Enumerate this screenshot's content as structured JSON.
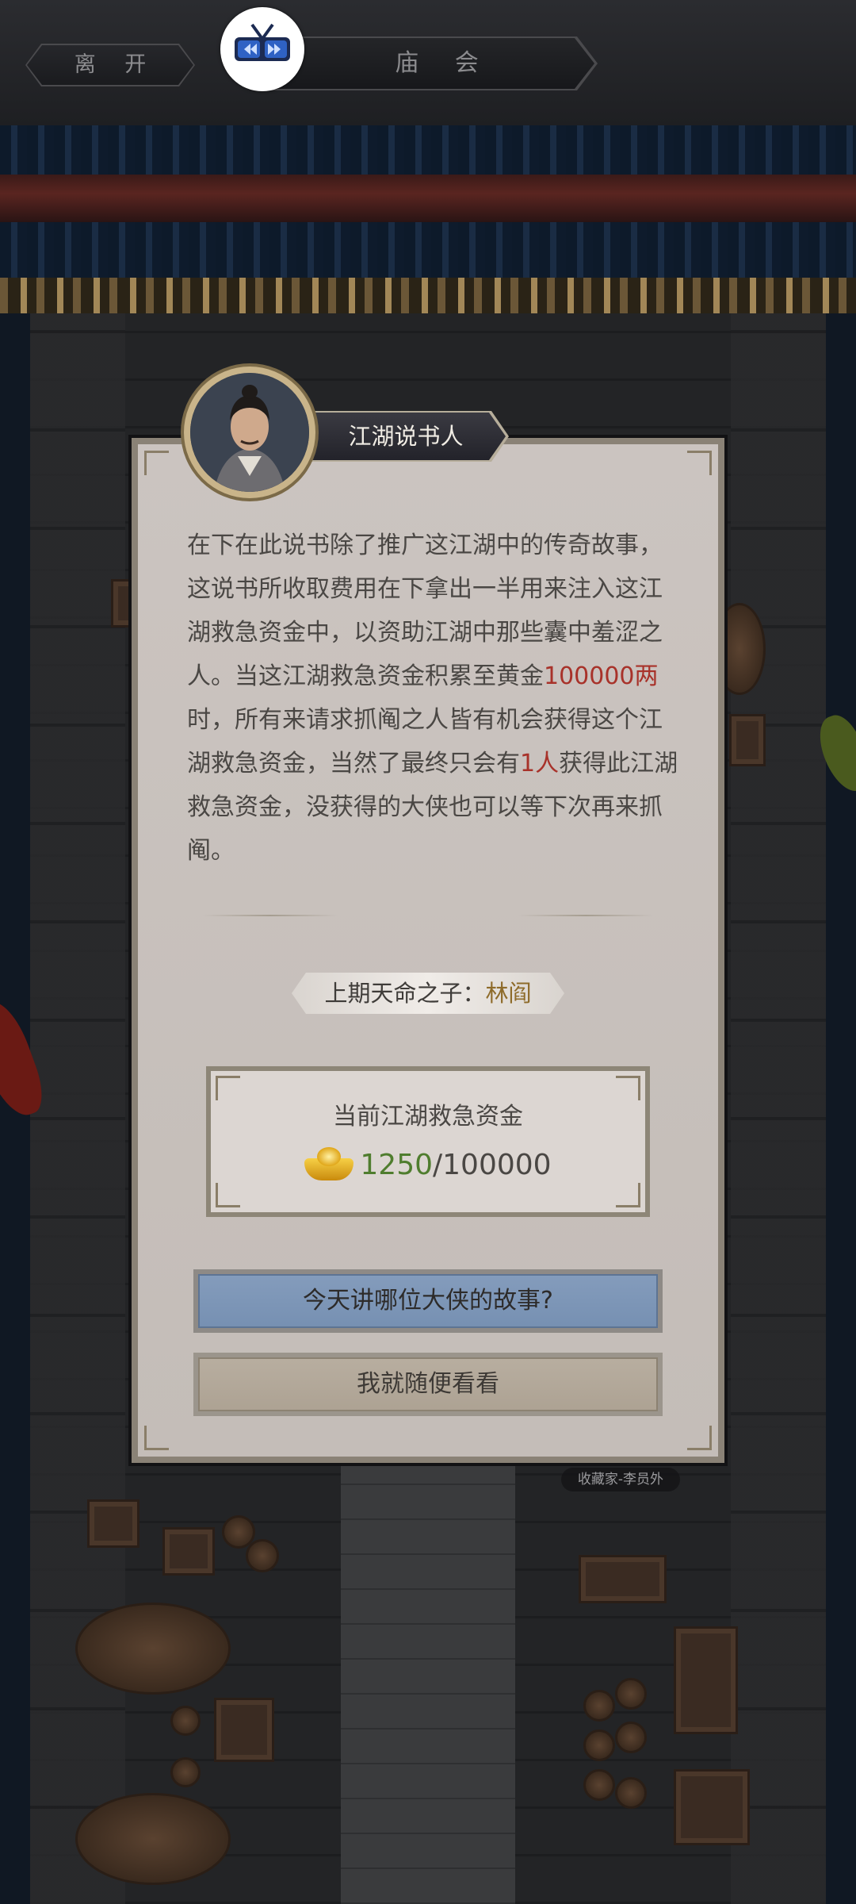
{
  "topbar": {
    "leave_label": "离 开",
    "title": "庙 会"
  },
  "scene": {
    "npc_label": "收藏家-李员外"
  },
  "dialog": {
    "npc_name": "江湖说书人",
    "story": {
      "part1": "在下在此说书除了推广这江湖中的传奇故事，这说书所收取费用在下拿出一半用来注入这江湖救急资金中，以资助江湖中那些囊中羞涩之人。当这江湖救急资金积累至黄金",
      "highlight_amount": "100000两",
      "part2": "时，所有来请求抓阄之人皆有机会获得这个江湖救急资金，当然了最终只会有",
      "highlight_count": "1人",
      "part3": "获得此江湖救急资金，没获得的大侠也可以等下次再来抓阄。"
    },
    "last_winner_label": "上期天命之子：",
    "last_winner_name": "林阎",
    "fund": {
      "title": "当前江湖救急资金",
      "current": "1250",
      "separator": "/",
      "goal": "100000",
      "icon": "gold-ingot-icon"
    },
    "primary_button": "今天讲哪位大侠的故事?",
    "secondary_button": "我就随便看看"
  },
  "colors": {
    "highlight_red": "#a8322a",
    "fund_green": "#4f7d2e",
    "winner_gold": "#8e6b2a",
    "primary_button_blue": "#7d96b8"
  }
}
